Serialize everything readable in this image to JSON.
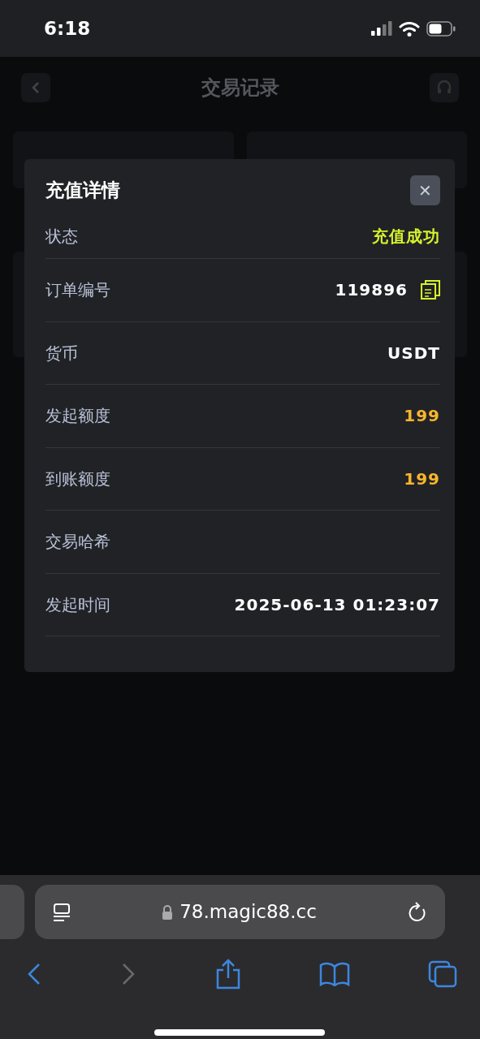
{
  "status_bar": {
    "time": "6:18"
  },
  "page": {
    "title": "交易记录"
  },
  "modal": {
    "title": "充值详情",
    "close_label": "✕",
    "rows": [
      {
        "label": "状态",
        "value": "充值成功",
        "color": "#d7f22b",
        "copy": false
      },
      {
        "label": "订单编号",
        "value": "119896",
        "color": "#ffffff",
        "copy": true
      },
      {
        "label": "货币",
        "value": "USDT",
        "color": "#ffffff",
        "copy": false
      },
      {
        "label": "发起额度",
        "value": "199",
        "color": "#f6b52c",
        "copy": false
      },
      {
        "label": "到账额度",
        "value": "199",
        "color": "#f6b52c",
        "copy": false
      },
      {
        "label": "交易哈希",
        "copy": false
      },
      {
        "label": "发起时间",
        "value": "2025-06-13 01:23:07",
        "color": "#ffffff",
        "copy": false
      }
    ]
  },
  "browser": {
    "url": "78.magic88.cc"
  }
}
